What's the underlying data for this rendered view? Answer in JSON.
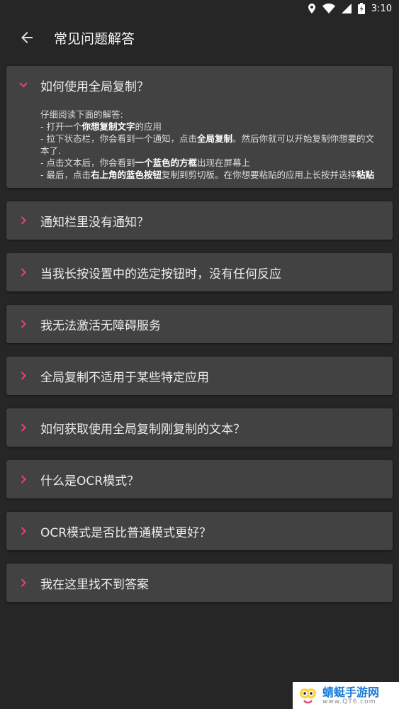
{
  "status": {
    "time": "3:10"
  },
  "appbar": {
    "title": "常见问题解答"
  },
  "faq": [
    {
      "question": "如何使用全局复制？",
      "expanded": true,
      "answer_lines": [
        [
          {
            "t": "仔细阅读下面的解答:"
          }
        ],
        [
          {
            "t": "- 打开一个"
          },
          {
            "t": "你想复制文字",
            "b": true
          },
          {
            "t": "的应用"
          }
        ],
        [
          {
            "t": "- 拉下状态栏，你会看到一个通知，点击"
          },
          {
            "t": "全局复制",
            "b": true
          },
          {
            "t": "。然后你就可以开始复制你想要的文本了."
          }
        ],
        [
          {
            "t": "- 点击文本后，你会看到"
          },
          {
            "t": "一个蓝色的方框",
            "b": true
          },
          {
            "t": "出现在屏幕上"
          }
        ],
        [
          {
            "t": "- 最后，点击"
          },
          {
            "t": "右上角的蓝色按钮",
            "b": true
          },
          {
            "t": "复制到剪切板。在你想要粘贴的应用上长按并选择"
          },
          {
            "t": "粘贴",
            "b": true
          }
        ]
      ]
    },
    {
      "question": "通知栏里没有通知？",
      "expanded": false
    },
    {
      "question": "当我长按设置中的选定按钮时，没有任何反应",
      "expanded": false
    },
    {
      "question": "我无法激活无障碍服务",
      "expanded": false
    },
    {
      "question": "全局复制不适用于某些特定应用",
      "expanded": false
    },
    {
      "question": "如何获取使用全局复制刚复制的文本？",
      "expanded": false
    },
    {
      "question": "什么是OCR模式？",
      "expanded": false
    },
    {
      "question": "OCR模式是否比普通模式更好？",
      "expanded": false
    },
    {
      "question": "我在这里找不到答案",
      "expanded": false
    }
  ],
  "watermark": {
    "main": "蜻蜓手游网",
    "sub": "www.QT6.com"
  },
  "colors": {
    "accent": "#e9436d",
    "card": "#424242",
    "background": "#262626"
  }
}
